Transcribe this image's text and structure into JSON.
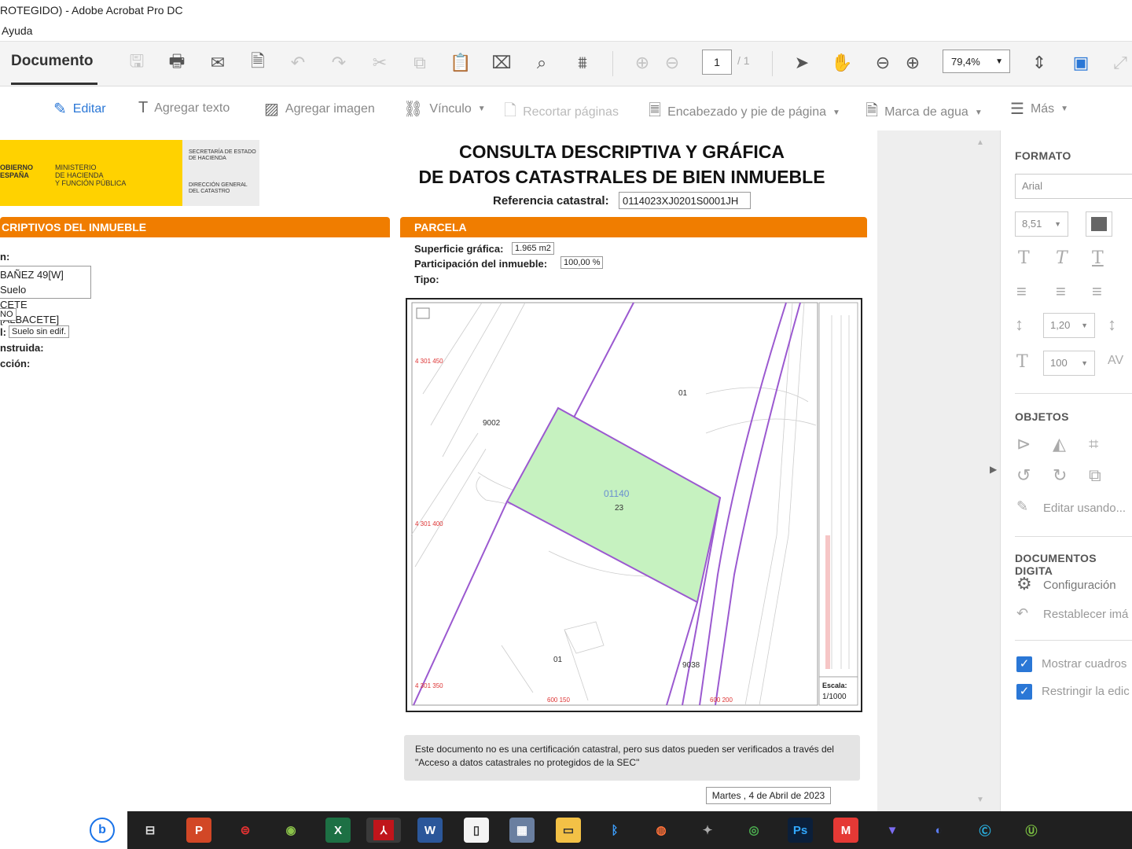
{
  "window": {
    "title": "ROTEGIDO) - Adobe Acrobat Pro DC",
    "menu": "Ayuda"
  },
  "toolbar": {
    "doc_tab": "Documento",
    "page_current": "1",
    "page_total": "/ 1",
    "zoom": "79,4%",
    "icons": [
      "save-icon",
      "print-icon",
      "mail-icon",
      "export-icon",
      "undo-icon",
      "redo-icon",
      "cut-icon",
      "copy-icon",
      "paste-icon",
      "snapshot-icon",
      "search-icon",
      "compare-icon",
      "page-up-icon",
      "page-down-icon",
      "select-icon",
      "hand-icon",
      "zoom-out-icon",
      "zoom-in-icon",
      "fit-page-icon",
      "read-mode-icon",
      "fullscreen-icon"
    ]
  },
  "edit_toolbar": {
    "edit": "Editar",
    "add_text": "Agregar texto",
    "add_image": "Agregar imagen",
    "link": "Vínculo",
    "crop": "Recortar páginas",
    "header_footer": "Encabezado y pie de página",
    "watermark": "Marca de agua",
    "more": "Más"
  },
  "document": {
    "logo": {
      "left1": "OBIERNO\nESPAÑA",
      "left2": "MINISTERIO\nDE HACIENDA\nY FUNCIÓN PÚBLICA",
      "right1": "SECRETARÍA DE ESTADO\nDE HACIENDA",
      "right2": "DIRECCIÓN GENERAL\nDEL CATASTRO"
    },
    "title_line1": "CONSULTA DESCRIPTIVA Y GRÁFICA",
    "title_line2": "DE DATOS CATASTRALES DE BIEN INMUEBLE",
    "ref_label": "Referencia catastral:",
    "ref_value": "0114023XJ0201S0001JH",
    "left_section": "CRIPTIVOS DEL INMUEBLE",
    "left_fields": {
      "f1": "n:",
      "address1": "BAÑEZ 49[W] Suelo",
      "address2": "CETE [ALBACETE]",
      "class_val": "NO",
      "use_label": "l:",
      "use_val": "Suelo sin edif.",
      "built_label": "nstruida:",
      "year_label": "cción:"
    },
    "parcel_section": "PARCELA",
    "surface_label": "Superficie gráfica:",
    "surface_value": "1.965 m2",
    "participation_label": "Participación del inmueble:",
    "participation_value": "100,00 %",
    "type_label": "Tipo:",
    "map": {
      "parcel_id": "01140",
      "parcel_num": "23",
      "label_01_top": "01",
      "label_9002": "9002",
      "label_01_bottom": "01",
      "label_9038": "9038",
      "coord_y1": "4 301 450",
      "coord_y2": "4 301 400",
      "coord_y3": "4 301 350",
      "coord_x1": "600 150",
      "coord_x2": "600 200",
      "scale_label": "Escala:",
      "scale_value": "1/1000"
    },
    "notice": "Este documento no es una certificación catastral, pero sus datos pueden ser verificados a través del \"Acceso a datos catastrales no protegidos de la SEC\"",
    "date": "Martes , 4 de Abril de 2023"
  },
  "right_panel": {
    "format_head": "FORMATO",
    "font": "Arial",
    "font_size": "8,51",
    "line_spacing": "1,20",
    "scale": "100",
    "objects_head": "OBJETOS",
    "edit_using": "Editar usando...",
    "digital_head": "DOCUMENTOS DIGITA",
    "config": "Configuración",
    "reset": "Restablecer imá",
    "show_boxes": "Mostrar cuadros",
    "restrict": "Restringir la edic"
  },
  "taskbar": {
    "apps": [
      "P",
      "W",
      "X",
      "Ps",
      "M"
    ]
  },
  "colors": {
    "orange": "#f07d00",
    "yellow": "#ffd200",
    "parcel_green": "#c6f2c0",
    "boundary_purple": "#9b59d0",
    "accent_blue": "#2a77d6"
  }
}
